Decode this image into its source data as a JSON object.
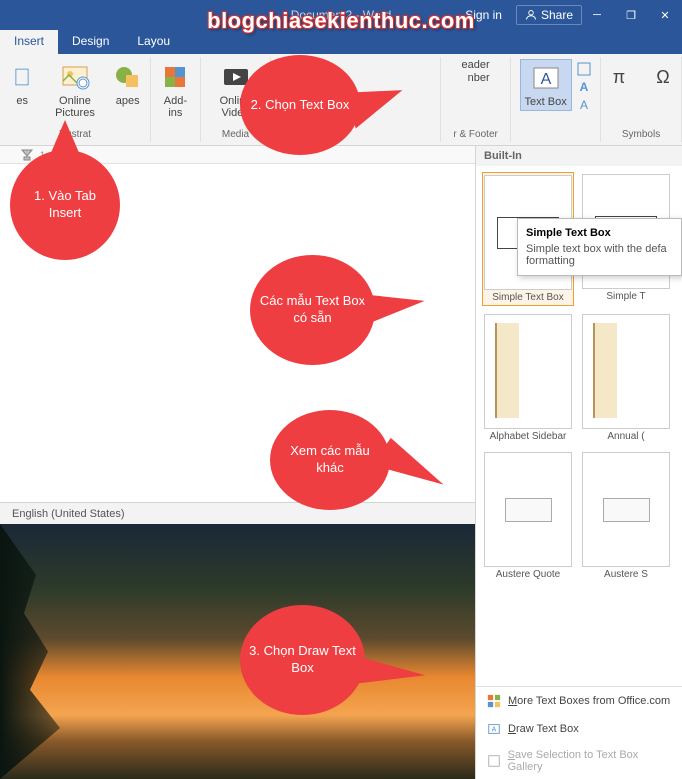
{
  "window": {
    "title": "Document2 - Word",
    "sign_in": "Sign in",
    "share": "Share"
  },
  "watermark": "blogchiasekienthuc.com",
  "tabs": {
    "insert": "Insert",
    "design": "Design",
    "layout": "Layou"
  },
  "ribbon": {
    "pictures_group": "Illustrat",
    "online_pictures": "Online Pictures",
    "shapes": "apes",
    "addins": "Add-ins",
    "online_video": "Online Video",
    "media": "Media",
    "header": "eader",
    "nber": "nber",
    "header_footer": "r & Footer",
    "textbox": "Text Box",
    "symbols": "Symbols"
  },
  "callouts": {
    "c1": "1. Vào Tab Insert",
    "c2": "2. Chọn Text Box",
    "c3": "Các mẫu Text Box có sẵn",
    "c4": "Xem các mẫu khác",
    "c5": "3. Chọn Draw Text Box"
  },
  "gallery": {
    "header": "Built-In",
    "items": [
      {
        "caption": "Simple Text Box",
        "style": "simple"
      },
      {
        "caption": "Simple T",
        "style": "simple"
      },
      {
        "caption": "Alphabet Sidebar",
        "style": "sidebar"
      },
      {
        "caption": "Annual (",
        "style": "sidebar"
      },
      {
        "caption": "Austere Quote",
        "style": "quote"
      },
      {
        "caption": "Austere S",
        "style": "quote"
      }
    ],
    "menu": {
      "more": "ore Text Boxes from Office.com",
      "more_prefix": "M",
      "draw": "raw Text Box",
      "draw_prefix": "D",
      "save": "ave Selection to Text Box Gallery",
      "save_prefix": "S"
    }
  },
  "tooltip": {
    "title": "Simple Text Box",
    "body": "Simple text box with the defa formatting"
  },
  "status": {
    "language": "English (United States)"
  }
}
